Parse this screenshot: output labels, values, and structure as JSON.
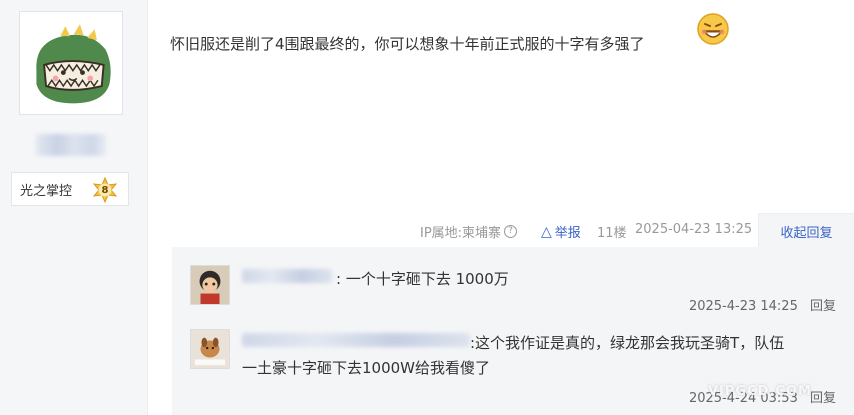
{
  "user": {
    "avatar_icon": "green-dinosaur-avatar",
    "badge_name": "光之掌控",
    "badge_level": "8"
  },
  "post": {
    "text": "怀旧服还是削了4围跟最终的，你可以想象十年前正式服的十字有多强了",
    "emoji_icon": "grinning-face-emoji"
  },
  "meta": {
    "ip_label": "IP属地:柬埔寨",
    "help_icon": "?",
    "report_icon": "△",
    "report_label": "举报",
    "floor": "11楼",
    "time": "2025-04-23 13:25",
    "collapse_label": "收起回复"
  },
  "replies": [
    {
      "text": ": 一个十字砸下去 1000万",
      "time": "2025-4-23 14:25",
      "reply_label": "回复"
    },
    {
      "text_line1": ":这个我作证是真的，绿龙那会我玩圣骑T，队伍",
      "text_line2": "一土豪十字砸下去1000W给我看傻了",
      "time": "2025-4-24 03:53",
      "reply_label": "回复"
    }
  ],
  "watermark": "VIPGCD.COM",
  "colors": {
    "accent_blue": "#3b63c8",
    "meta_gray": "#999999",
    "reply_bg": "#f4f5f7"
  }
}
